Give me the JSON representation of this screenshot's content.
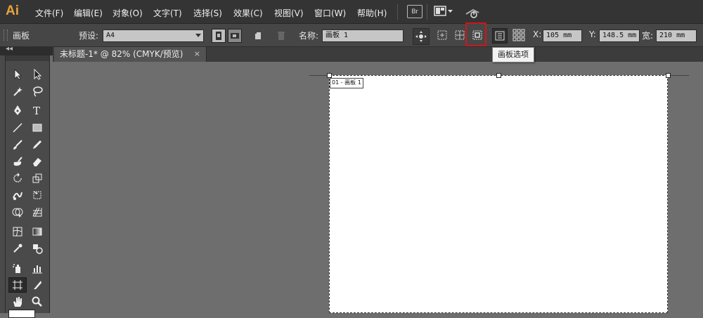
{
  "app": {
    "logo": "Ai"
  },
  "menu": [
    "文件(F)",
    "编辑(E)",
    "对象(O)",
    "文字(T)",
    "选择(S)",
    "效果(C)",
    "视图(V)",
    "窗口(W)",
    "帮助(H)"
  ],
  "menu_right": {
    "bridge_label": "Br"
  },
  "control_bar": {
    "artboard_label": "画板",
    "preset_label": "预设:",
    "preset_value": "A4",
    "name_label": "名称:",
    "name_value": "画板 1",
    "x_label": "X:",
    "x_value": "105 mm",
    "y_label": "Y:",
    "y_value": "148.5 mm",
    "w_label": "宽:",
    "w_value": "210 mm"
  },
  "tooltip": "画板选项",
  "document_tab": {
    "title": "未标题-1* @ 82% (CMYK/预览)",
    "close": "×"
  },
  "artboard": {
    "label": "01 - 画板 1"
  },
  "colors": {
    "highlight": "#d0141c",
    "logo": "#e8a23c"
  }
}
